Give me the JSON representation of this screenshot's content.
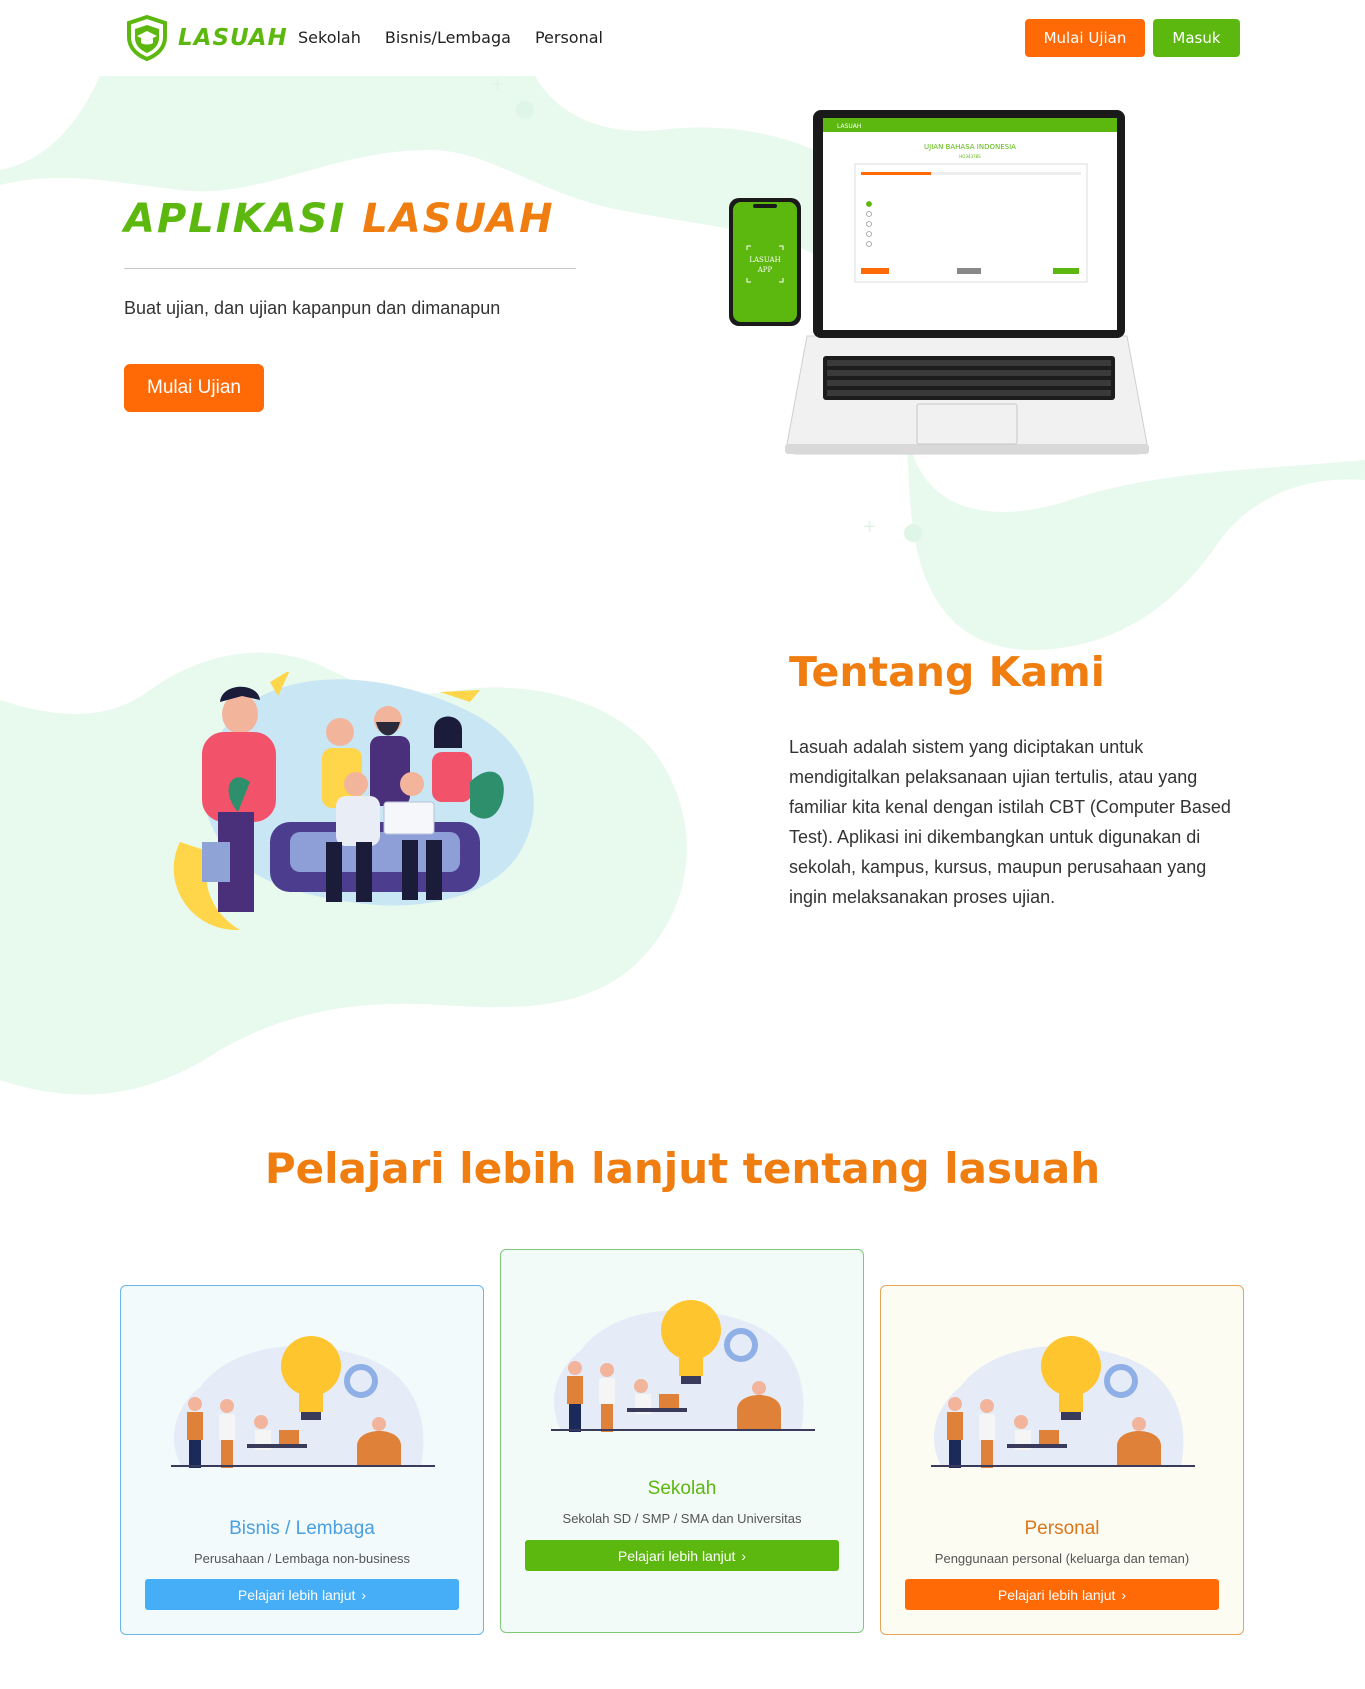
{
  "brand": {
    "name": "LASUAH",
    "green": "#5cb80e",
    "orange": "#ff6a07",
    "title_orange": "#ef7d10",
    "blob_mint": "#e8f9ee"
  },
  "nav": {
    "links": [
      "Sekolah",
      "Bisnis/Lembaga",
      "Personal"
    ],
    "start_exam_label": "Mulai Ujian",
    "login_label": "Masuk"
  },
  "hero": {
    "title_part1": "APLIKASI",
    "title_part2": "LASUAH",
    "subtitle": "Buat ujian, dan ujian kapanpun dan dimanapun",
    "cta_label": "Mulai Ujian",
    "phone_label_line1": "LASUAH",
    "phone_label_line2": "APP",
    "laptop_screen": {
      "app_name": "LASUAH",
      "exam_title": "UJIAN BAHASA INDONESIA",
      "exam_code": "HO34378S"
    }
  },
  "about": {
    "title": "Tentang Kami",
    "text": "Lasuah adalah sistem yang diciptakan untuk mendigitalkan pelaksanaan ujian tertulis, atau yang familiar kita kenal dengan istilah CBT (Computer Based Test). Aplikasi ini dikembangkan untuk digunakan di sekolah, kampus, kursus, maupun perusahaan yang ingin melaksanakan proses ujian."
  },
  "learn_more": {
    "title": "Pelajari lebih lanjut tentang lasuah",
    "cards": [
      {
        "title": "Bisnis / Lembaga",
        "description": "Perusahaan / Lembaga non-business",
        "button": "Pelajari lebih lanjut",
        "chevron_icon": "chevron-right-icon",
        "accent": "#45aef7"
      },
      {
        "title": "Sekolah",
        "description": "Sekolah SD / SMP / SMA dan Universitas",
        "button": "Pelajari lebih lanjut",
        "chevron_icon": "chevron-right-icon",
        "accent": "#5cb80e"
      },
      {
        "title": "Personal",
        "description": "Penggunaan personal (keluarga dan teman)",
        "button": "Pelajari lebih lanjut",
        "chevron_icon": "chevron-right-icon",
        "accent": "#ff6a07"
      }
    ]
  }
}
